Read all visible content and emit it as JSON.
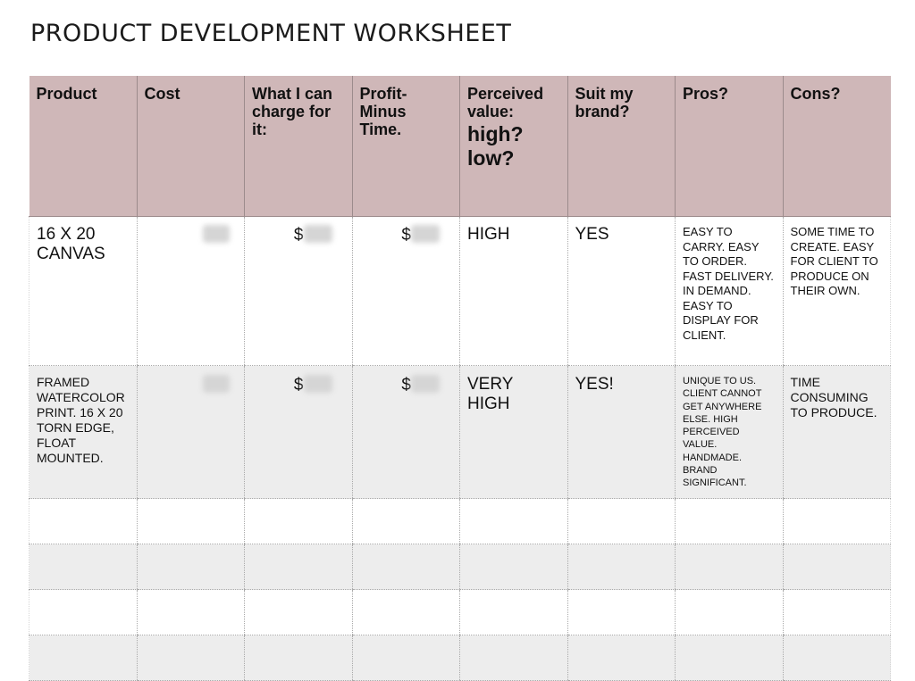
{
  "title": "PRODUCT DEVELOPMENT WORKSHEET",
  "headers": {
    "product": "Product",
    "cost": "Cost",
    "charge": "What I can charge for it:",
    "profit": "Profit- Minus Time.",
    "perceived": "Perceived value:",
    "perceived_options": "high? low?",
    "brand": "Suit my brand?",
    "pros": "Pros?",
    "cons": "Cons?"
  },
  "rows": [
    {
      "product": "16 X 20 CANVAS",
      "currency_charge": "$",
      "currency_profit": "$",
      "perceived": "HIGH",
      "brand": "YES",
      "pros": "EASY TO CARRY. EASY TO ORDER. FAST DELIVERY. IN DEMAND. EASY TO DISPLAY FOR CLIENT.",
      "cons": "SOME TIME TO CREATE. EASY FOR CLIENT TO PRODUCE ON THEIR OWN."
    },
    {
      "product": "FRAMED WATERCOLOR PRINT. 16 X 20 TORN EDGE, FLOAT MOUNTED.",
      "currency_charge": "$",
      "currency_profit": "$",
      "perceived": "VERY HIGH",
      "brand": "YES!",
      "pros": "UNIQUE TO US. CLIENT CANNOT GET ANYWHERE ELSE. HIGH PERCEIVED VALUE. HANDMADE. BRAND SIGNIFICANT.",
      "cons": "TIME CONSUMING TO PRODUCE."
    }
  ],
  "blank_rows": 4
}
